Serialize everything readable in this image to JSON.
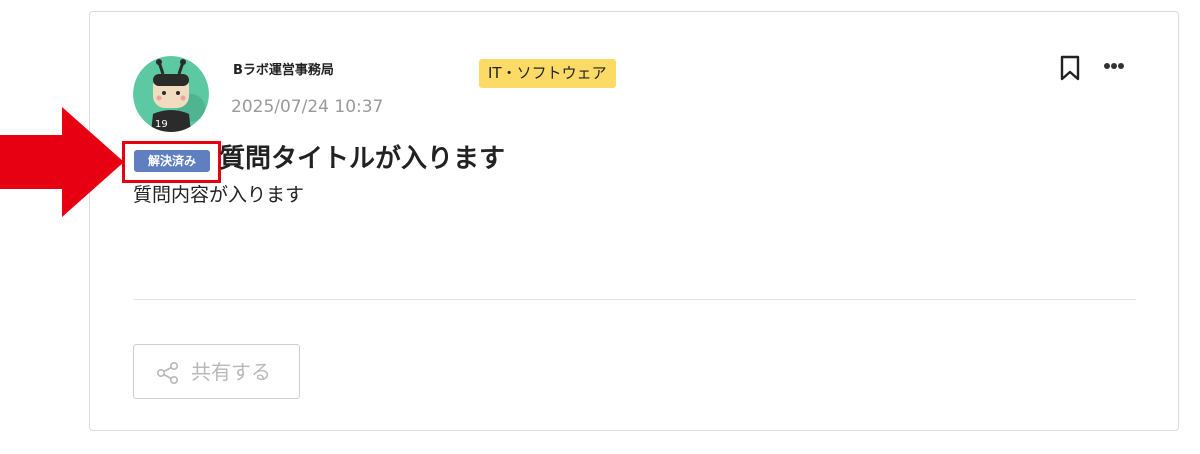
{
  "post": {
    "author": "Bラボ運営事務局",
    "date": "2025/07/24 10:37",
    "category": "IT・ソフトウェア",
    "status_badge": "解決済み",
    "title": "質問タイトルが入ります",
    "body": "質問内容が入ります",
    "avatar_number": "19"
  },
  "actions": {
    "share_label": "共有する"
  },
  "colors": {
    "category_bg": "#fbdb66",
    "badge_bg": "#5f7fc0",
    "highlight": "#e60012",
    "avatar_bg": "#5cc9a3"
  },
  "icons": [
    "bookmark-icon",
    "more-icon",
    "share-icon",
    "arrow-right-icon"
  ]
}
